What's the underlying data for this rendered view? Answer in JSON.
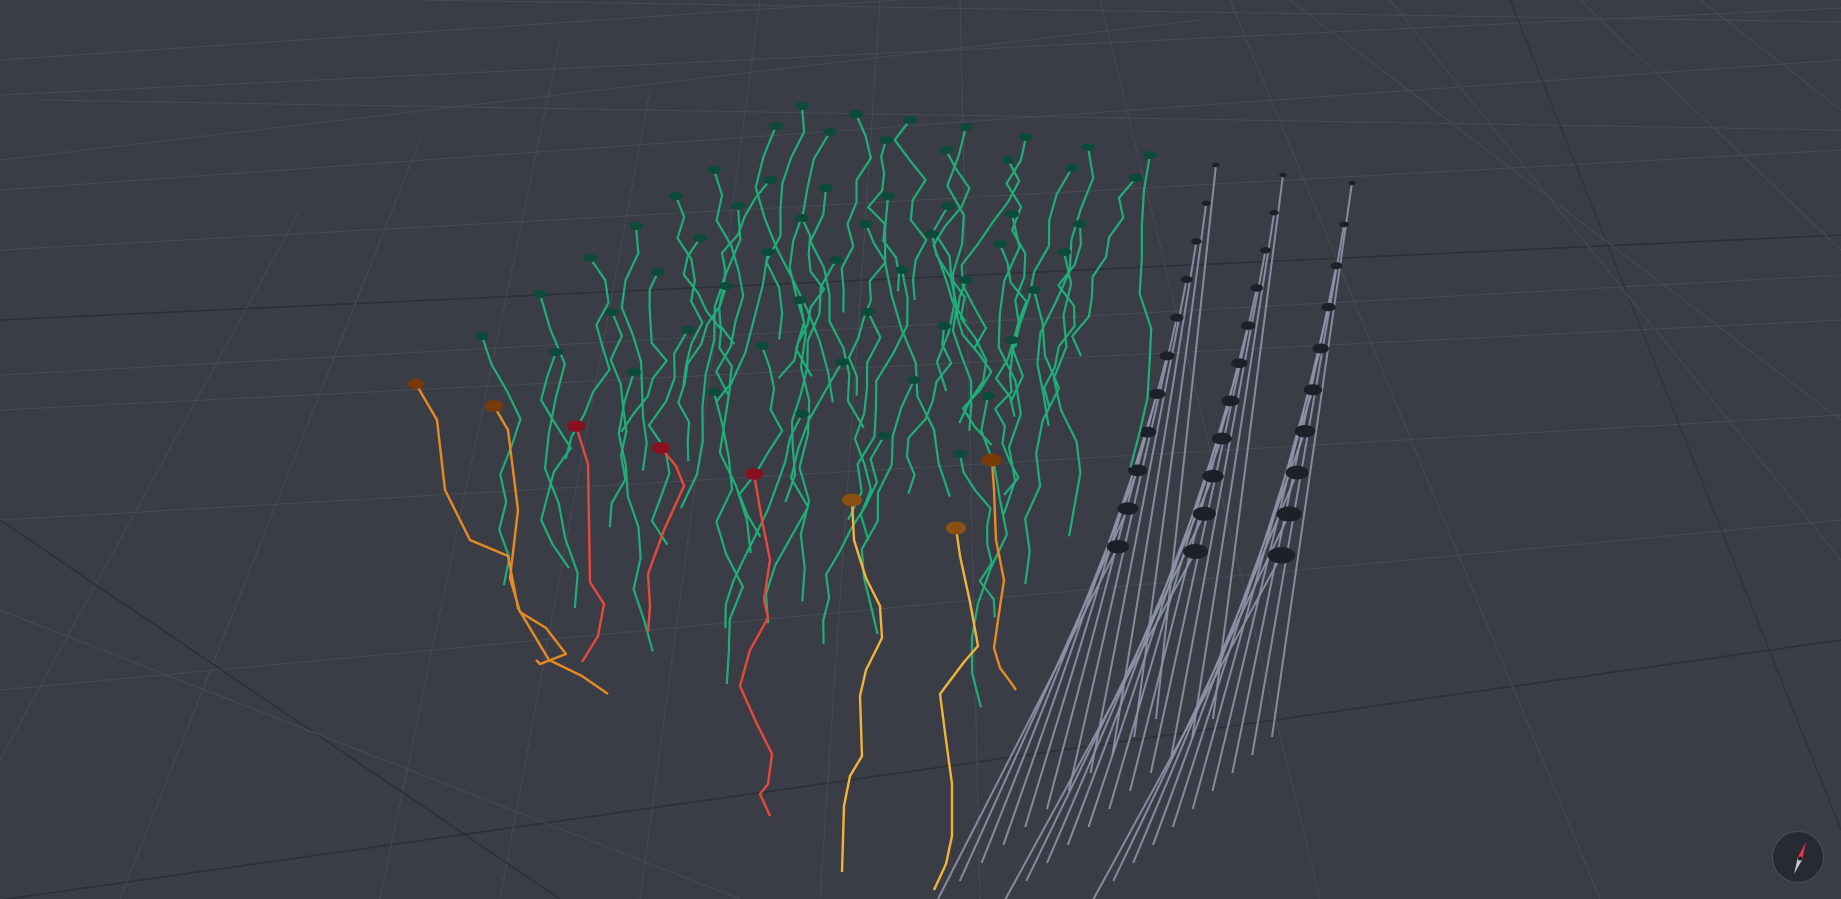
{
  "scene": {
    "background": "#3a3d46",
    "grid_color": "#474b55",
    "grid_major_color": "#2c2f37",
    "colors": {
      "green": "#1fae7a",
      "green_cap": "#0c4a3a",
      "orange": "#e88a22",
      "orange_cap": "#7a3a08",
      "red": "#e8483a",
      "red_cap": "#8a1020",
      "yellow": "#f2b33a",
      "yellow_cap": "#8a5010",
      "grey": "#8f94a8",
      "grey_cap": "#1c2029"
    }
  },
  "compass": {
    "icon": "compass-needle-icon",
    "needle_color": "#e8364a",
    "tail_color": "#c8cbd4"
  }
}
